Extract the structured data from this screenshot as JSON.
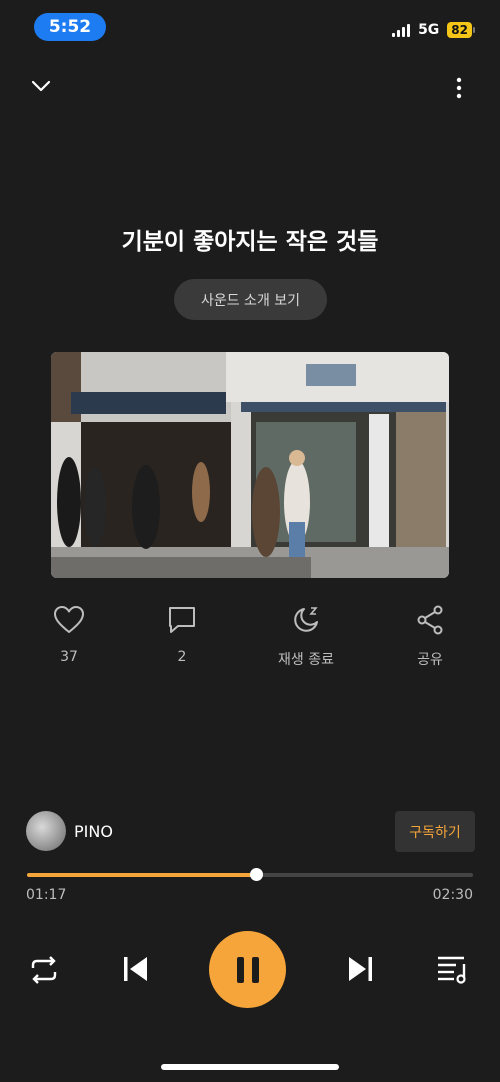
{
  "status_bar": {
    "time": "5:52",
    "network": "5G",
    "battery": "82"
  },
  "player": {
    "title": "기분이 좋아지는 작은 것들",
    "intro_button": "사운드 소개 보기",
    "actions": {
      "like_count": "37",
      "comment_count": "2",
      "sleep_timer_label": "재생 종료",
      "share_label": "공유"
    },
    "artist": {
      "name": "PINO",
      "subscribe_label": "구독하기"
    },
    "progress": {
      "current": "01:17",
      "total": "02:30",
      "fraction": 0.513
    }
  },
  "colors": {
    "accent": "#f5a53a",
    "background": "#1c1c1c",
    "status_pill": "#1e7cf2",
    "battery": "#f5c518"
  },
  "icons": [
    "chevron-down-icon",
    "more-vertical-icon",
    "heart-icon",
    "comment-icon",
    "moon-sleep-icon",
    "share-icon",
    "repeat-icon",
    "skip-previous-icon",
    "pause-icon",
    "skip-next-icon",
    "playlist-icon"
  ]
}
